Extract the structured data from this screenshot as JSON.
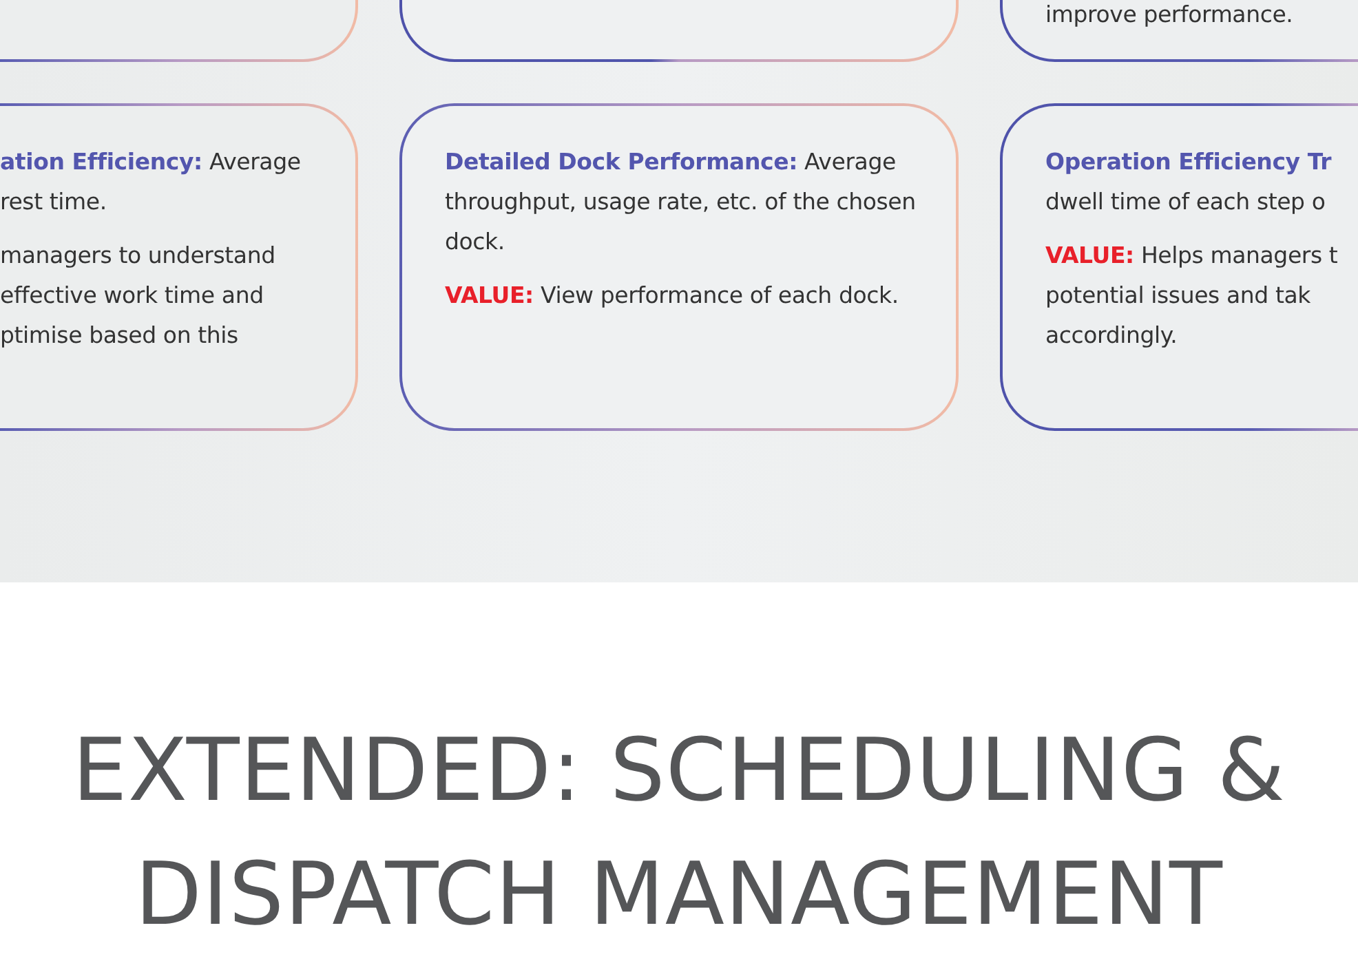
{
  "top_cards": [
    {
      "kind": "cut_left"
    },
    {
      "kind": "full"
    },
    {
      "kind": "cut_right",
      "paragraphs": [
        {
          "text": "improve performance."
        }
      ]
    }
  ],
  "bottom_cards": [
    {
      "kind": "cut_left",
      "paragraphs": [
        {
          "kind": "feature",
          "text": "**ation Efficiency:** Average\nrest time."
        },
        {
          "kind": "value",
          "text": "managers to understand\neffective work time and\nptimise based on this"
        }
      ]
    },
    {
      "kind": "full",
      "paragraphs": [
        {
          "kind": "feature",
          "text": "**Detailed Dock Performance:** Average throughput, usage rate, etc. of the chosen dock."
        },
        {
          "kind": "value",
          "text": "**VALUE:** View performance of each dock."
        }
      ]
    },
    {
      "kind": "cut_right",
      "paragraphs": [
        {
          "kind": "feature",
          "text": "**Operation Efficiency Tr**\ndwell time of each step o"
        },
        {
          "kind": "value",
          "text": "**VALUE:** Helps managers t\npotential issues and tak\naccordingly."
        }
      ]
    }
  ],
  "heading": "EXTENDED: SCHEDULING & DISPATCH MANAGEMENT"
}
